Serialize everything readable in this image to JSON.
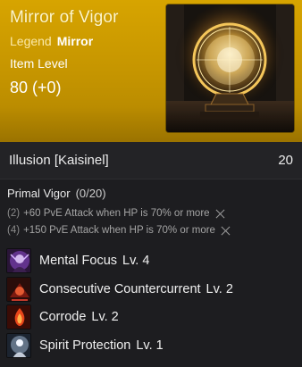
{
  "item": {
    "name": "Mirror of Vigor",
    "grade": "Legend",
    "type": "Mirror",
    "level_label": "Item Level",
    "level_value": "80 (+0)",
    "image_icon": "glowing-mirror-icon"
  },
  "illusion": {
    "name": "Illusion [Kaisinel]",
    "value": "20"
  },
  "set_bonus": {
    "title": "Primal Vigor",
    "count": "(0/20)",
    "bonuses": [
      {
        "tier": "(2)",
        "text": "+60 PvE Attack when HP is 70% or more"
      },
      {
        "tier": "(4)",
        "text": "+150 PvE Attack when HP is 70% or more"
      }
    ]
  },
  "skills": [
    {
      "name": "Mental Focus",
      "level": "Lv. 4",
      "icon": "mental-focus-icon"
    },
    {
      "name": "Consecutive Countercurrent",
      "level": "Lv. 2",
      "icon": "countercurrent-icon"
    },
    {
      "name": "Corrode",
      "level": "Lv. 2",
      "icon": "corrode-icon"
    },
    {
      "name": "Spirit Protection",
      "level": "Lv. 1",
      "icon": "spirit-protection-icon"
    }
  ],
  "colors": {
    "header_gold": "#c49400",
    "background": "#1d1d20",
    "grade_text": "#fbe9a8"
  }
}
